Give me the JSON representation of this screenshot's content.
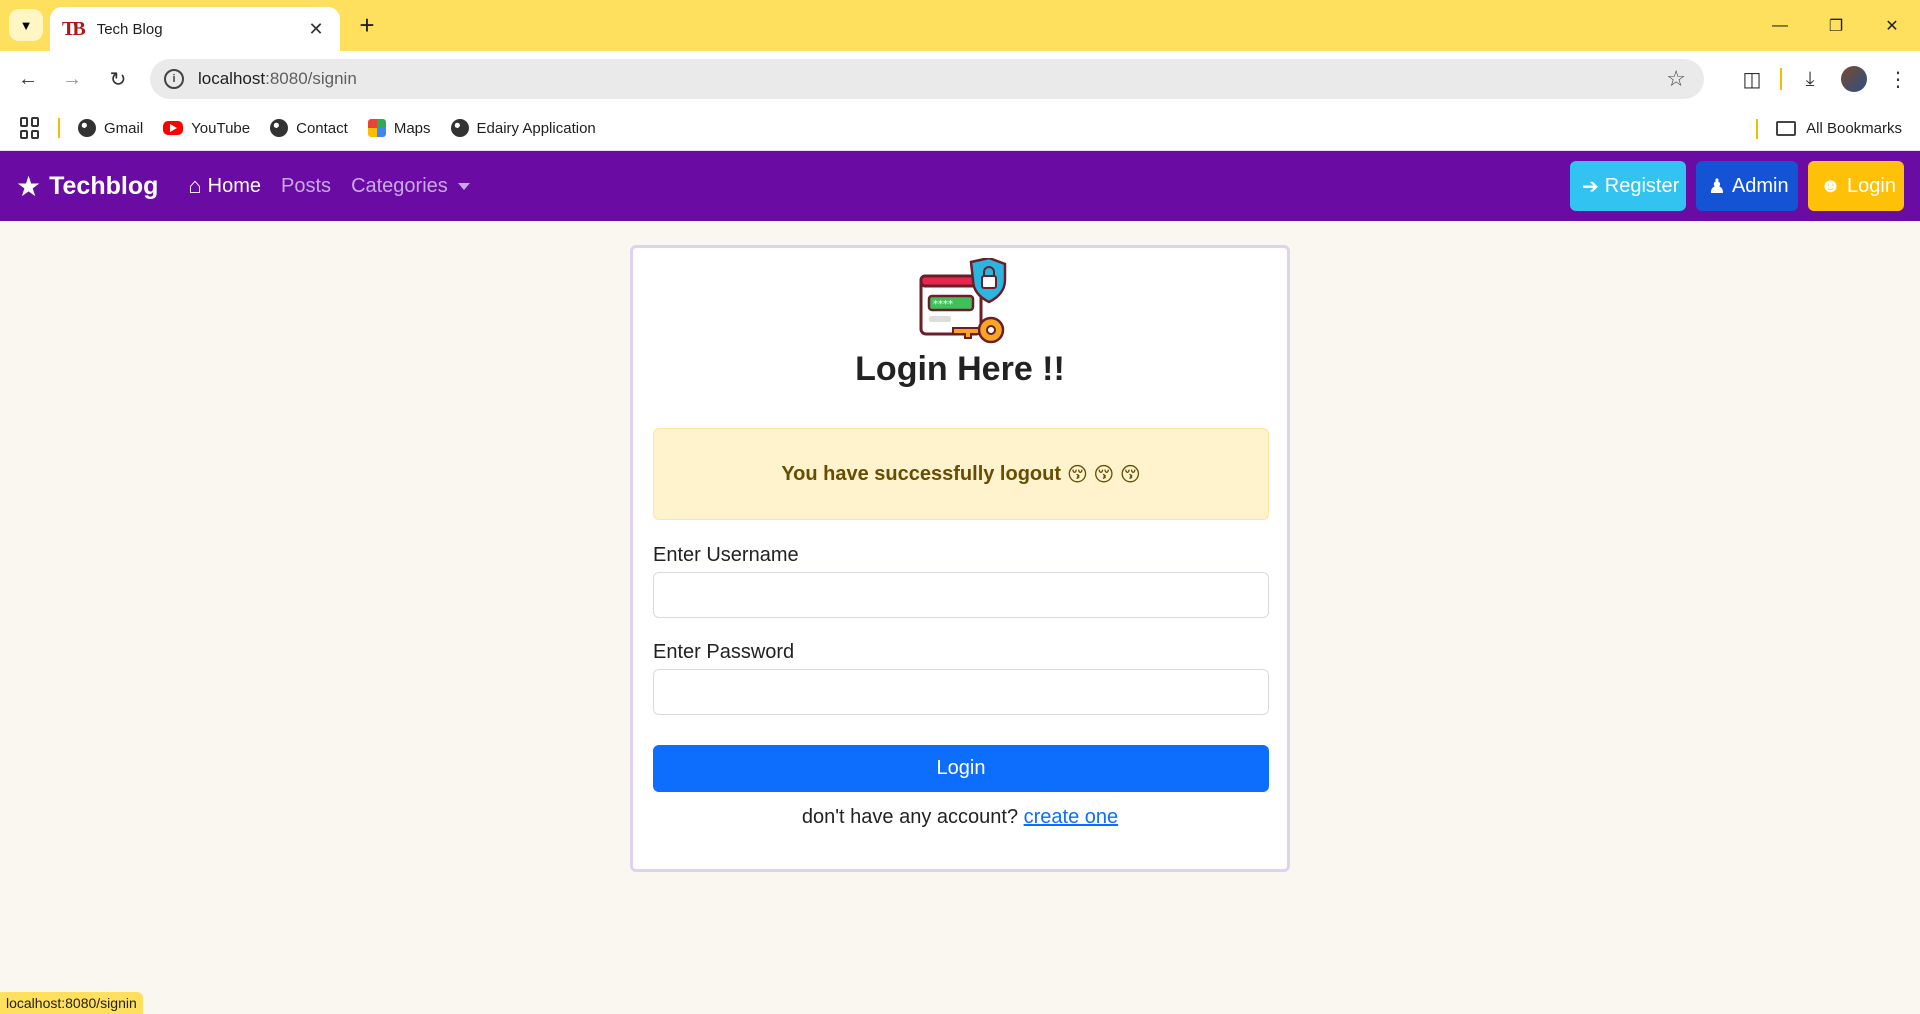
{
  "browser": {
    "tab_title": "Tech Blog",
    "tab_favicon": "TB",
    "url_host": "localhost",
    "url_rest": ":8080/signin",
    "bookmarks": [
      {
        "label": "Gmail",
        "icon": "globe-icon"
      },
      {
        "label": "YouTube",
        "icon": "youtube-icon"
      },
      {
        "label": "Contact",
        "icon": "globe-icon"
      },
      {
        "label": "Maps",
        "icon": "maps-icon"
      },
      {
        "label": "Edairy Application",
        "icon": "globe-icon"
      }
    ],
    "all_bookmarks": "All Bookmarks",
    "status_url": "localhost:8080/signin"
  },
  "navbar": {
    "brand": "Techblog",
    "links": [
      {
        "label": "Home",
        "active": true
      },
      {
        "label": "Posts",
        "active": false
      },
      {
        "label": "Categories",
        "active": false
      }
    ],
    "buttons": {
      "register": "Register",
      "admin": "Admin",
      "login": "Login"
    },
    "colors": {
      "bg": "#6a0ba3",
      "register": "#33c3f0",
      "admin": "#1453d4",
      "login": "#ffc107"
    }
  },
  "login_card": {
    "title": "Login Here !!",
    "alert": "You have successfully logout",
    "alert_emoji": "😚 😚 😚",
    "username_label": "Enter Username",
    "username_value": "",
    "password_label": "Enter Password",
    "password_value": "",
    "submit_label": "Login",
    "footer_text": "don't have any account?",
    "footer_link": "create one"
  }
}
